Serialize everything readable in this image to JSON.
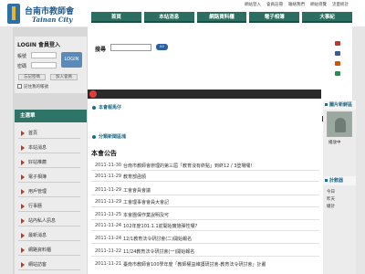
{
  "header": {
    "title": "台南市教師會",
    "subtitle_en": "Tainan City",
    "top_links": [
      "網站登入",
      "會員註冊",
      "聯絡我們",
      "網站導覽",
      "流量統計"
    ]
  },
  "nav": [
    "首頁",
    "本站消息",
    "網路資料櫃",
    "電子相簿",
    "大事紀"
  ],
  "login": {
    "title": "LOGIN 會員登入",
    "account_label": "帳號",
    "password_label": "密碼",
    "submit": "LOGIN",
    "forgot": "忘記密碼",
    "register": "加入會員",
    "remember": "記住我的帳號"
  },
  "menu": {
    "title": "主選單",
    "items": [
      "首頁",
      "本站消息",
      "好站推薦",
      "電子相簿",
      "用戶管理",
      "行事曆",
      "站內私人訊息",
      "最新消息",
      "網路資料櫃",
      "網站訪客"
    ]
  },
  "search": {
    "label": "搜尋",
    "button": "GO"
  },
  "sections": {
    "host": "本會報馬仔",
    "category": "分類新聞區塊"
  },
  "news": {
    "heading": "本會公告",
    "items": [
      {
        "date": "2011-11-30",
        "title": "台南市教師會辦理的第三屆「教育沒有終點」到終12 / 3登場囉!"
      },
      {
        "date": "2011-11-29",
        "title": "教育部函頒"
      },
      {
        "date": "2011-11-29",
        "title": "工會會員會議"
      },
      {
        "date": "2011-11-29",
        "title": "工會理事會會員大會記"
      },
      {
        "date": "2011-11-25",
        "title": "本會團保作業說明及可"
      },
      {
        "date": "2011-11-24",
        "title": "102年度101.1.1前開始實施彈性囉?"
      },
      {
        "date": "2011-11-24",
        "title": "12/1教育法令研討會(二)開始報名"
      },
      {
        "date": "2011-11-22",
        "title": "11/24教育法令研討會(一)開始報名"
      },
      {
        "date": "2011-11-21",
        "title": "臺南市教師會100學年度「教師權益維護研討會-教育法令研討會」計畫"
      }
    ]
  },
  "right": {
    "photo_head": "圖片新鮮區",
    "caption": "播放中",
    "stats_head": "計數器",
    "stats": [
      "今日",
      "昨天",
      "總計"
    ]
  },
  "colors": {
    "nav_green": "#2c6f62",
    "menu_green": "#2f7567",
    "brand_blue": "#1f5a8a",
    "background_gray": "#e6e6e6"
  },
  "icons": [
    "logo-icon",
    "search-button",
    "facebook-icon",
    "plurk-icon",
    "twitter-icon",
    "rss-icon"
  ]
}
